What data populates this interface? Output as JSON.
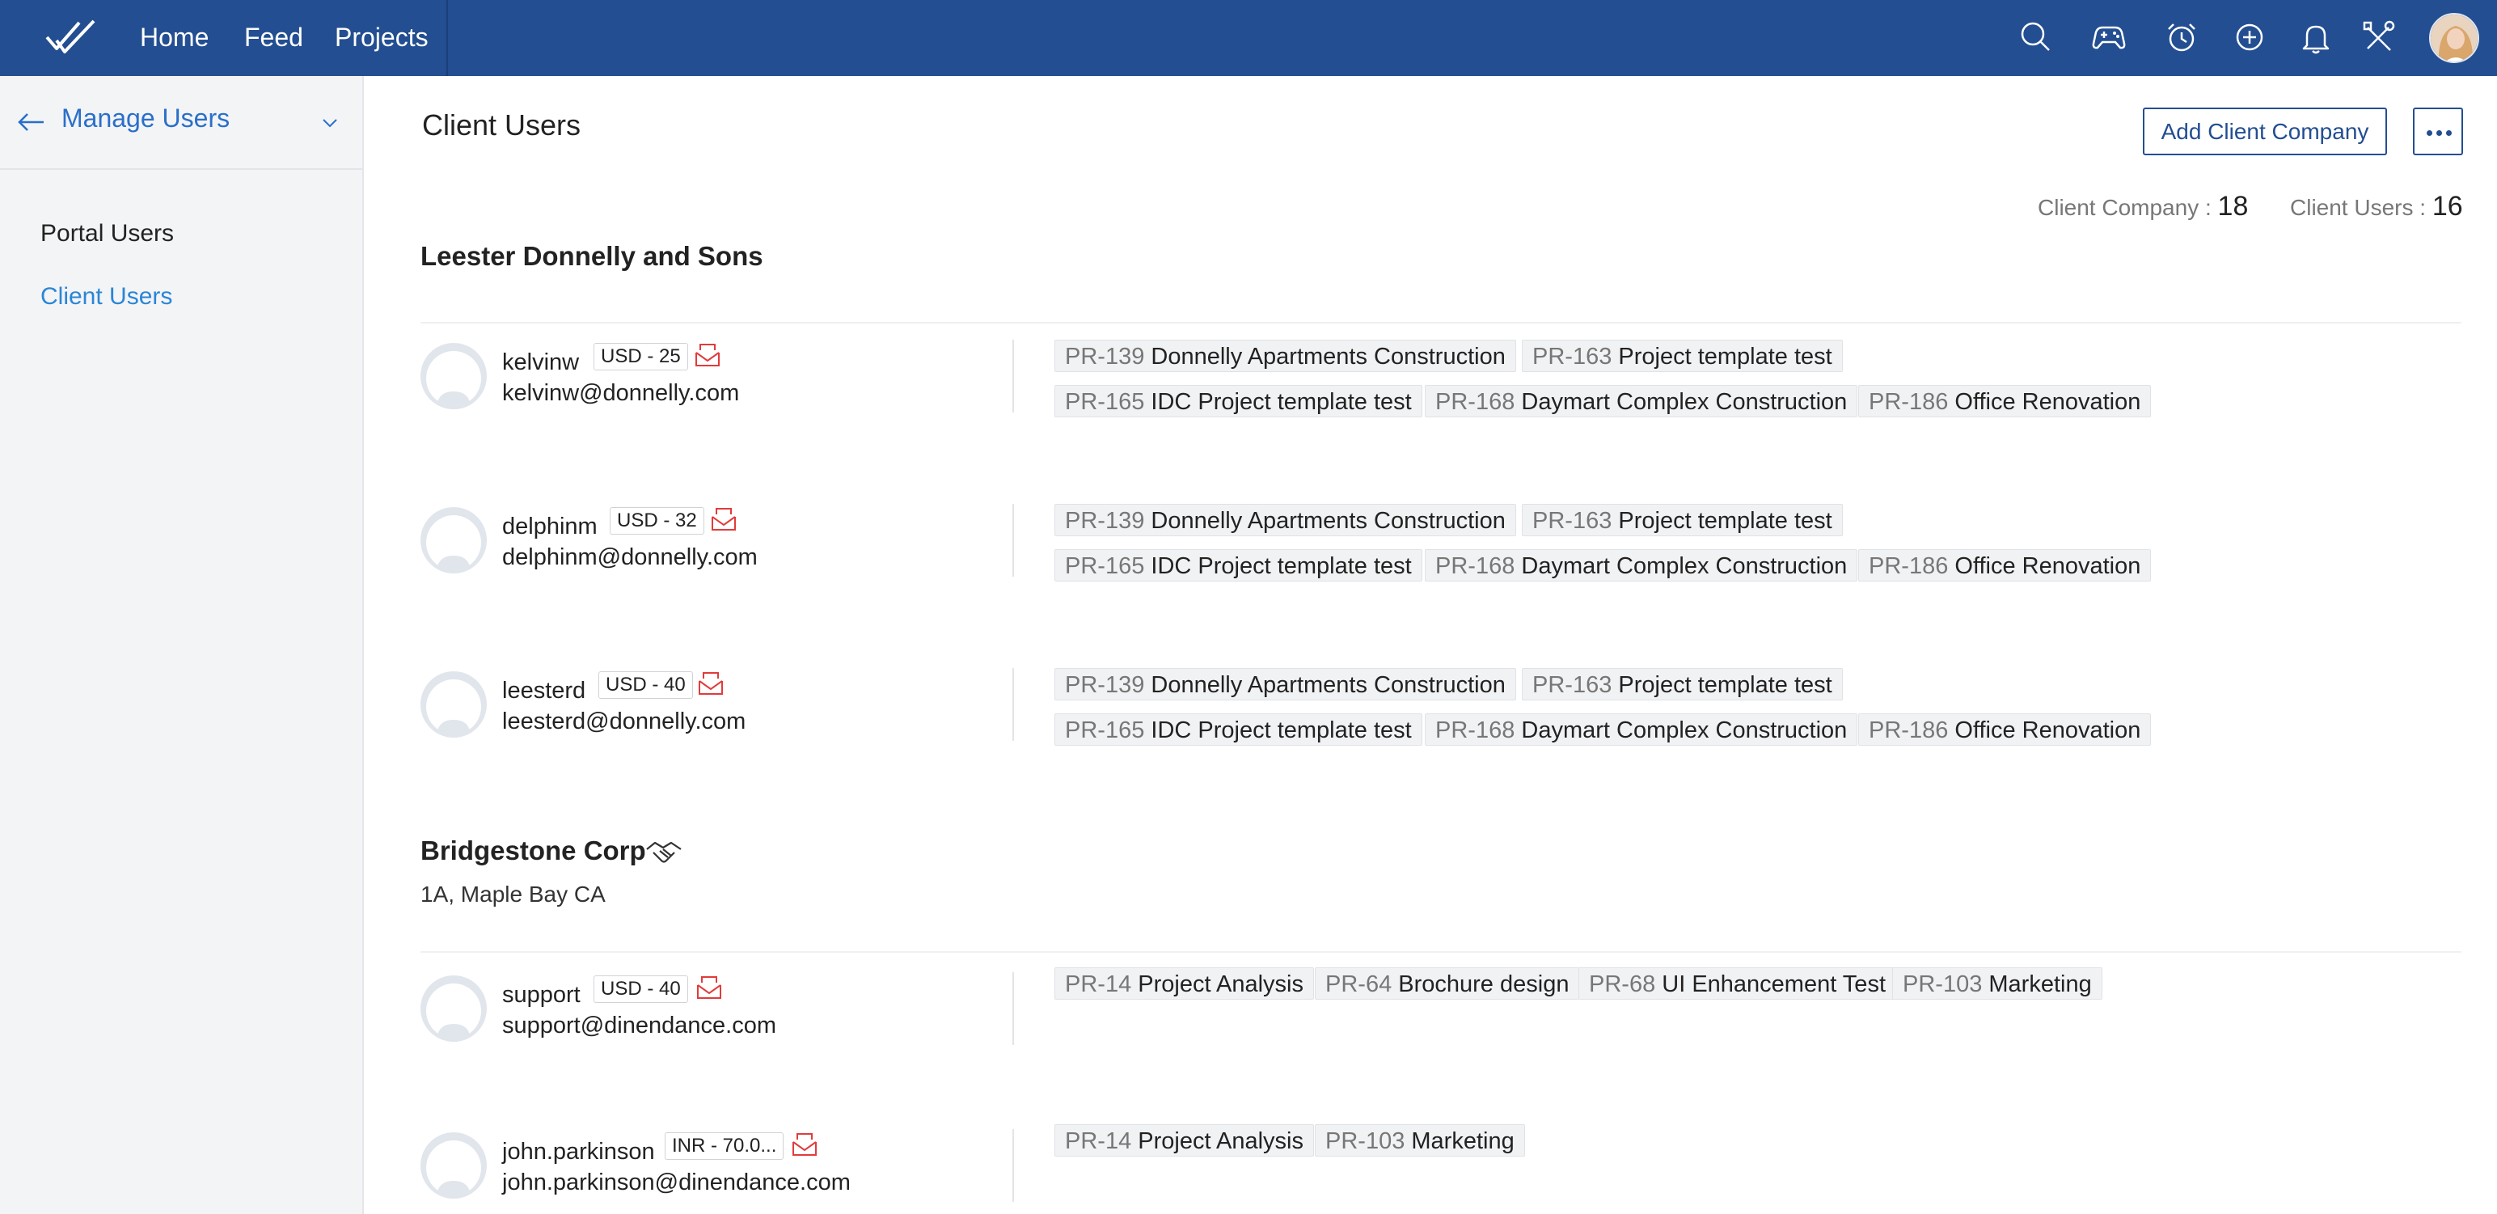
{
  "nav": {
    "home": "Home",
    "feed": "Feed",
    "projects": "Projects",
    "icons": [
      "search-icon",
      "gamepad-icon",
      "timer-icon",
      "add-icon",
      "bell-icon",
      "tools-icon"
    ]
  },
  "sidebar": {
    "title": "Manage Users",
    "items": [
      {
        "label": "Portal Users",
        "active": false
      },
      {
        "label": "Client Users",
        "active": true
      }
    ]
  },
  "main": {
    "title": "Client Users",
    "add_button": "Add Client Company",
    "stats": {
      "company_label": "Client Company : ",
      "company_count": "18",
      "users_label": "Client Users : ",
      "users_count": "16"
    }
  },
  "companies": [
    {
      "name": "Leester Donnelly and Sons",
      "users": [
        {
          "username": "kelvinw",
          "rate": "USD - 25",
          "email": "kelvinw@donnelly.com",
          "projects": [
            {
              "code": "PR-139",
              "name": "Donnelly Apartments Construction"
            },
            {
              "code": "PR-163",
              "name": "Project template test"
            },
            {
              "code": "PR-165",
              "name": "IDC Project template test"
            },
            {
              "code": "PR-168",
              "name": "Daymart Complex Construction"
            },
            {
              "code": "PR-186",
              "name": "Office Renovation"
            }
          ]
        },
        {
          "username": "delphinm",
          "rate": "USD - 32",
          "email": "delphinm@donnelly.com",
          "projects": [
            {
              "code": "PR-139",
              "name": "Donnelly Apartments Construction"
            },
            {
              "code": "PR-163",
              "name": "Project template test"
            },
            {
              "code": "PR-165",
              "name": "IDC Project template test"
            },
            {
              "code": "PR-168",
              "name": "Daymart Complex Construction"
            },
            {
              "code": "PR-186",
              "name": "Office Renovation"
            }
          ]
        },
        {
          "username": "leesterd",
          "rate": "USD - 40",
          "email": "leesterd@donnelly.com",
          "projects": [
            {
              "code": "PR-139",
              "name": "Donnelly Apartments Construction"
            },
            {
              "code": "PR-163",
              "name": "Project template test"
            },
            {
              "code": "PR-165",
              "name": "IDC Project template test"
            },
            {
              "code": "PR-168",
              "name": "Daymart Complex Construction"
            },
            {
              "code": "PR-186",
              "name": "Office Renovation"
            }
          ]
        }
      ]
    },
    {
      "name": "Bridgestone Corp",
      "address": "1A, Maple Bay CA",
      "users": [
        {
          "username": "support",
          "rate": "USD - 40",
          "email": "support@dinendance.com",
          "projects": [
            {
              "code": "PR-14",
              "name": "Project Analysis"
            },
            {
              "code": "PR-64",
              "name": "Brochure design"
            },
            {
              "code": "PR-68",
              "name": "UI Enhancement Test"
            },
            {
              "code": "PR-103",
              "name": "Marketing"
            }
          ]
        },
        {
          "username": "john.parkinson",
          "rate": "INR - 70.0...",
          "email": "john.parkinson@dinendance.com",
          "projects": [
            {
              "code": "PR-14",
              "name": "Project Analysis"
            },
            {
              "code": "PR-103",
              "name": "Marketing"
            }
          ]
        }
      ]
    }
  ]
}
